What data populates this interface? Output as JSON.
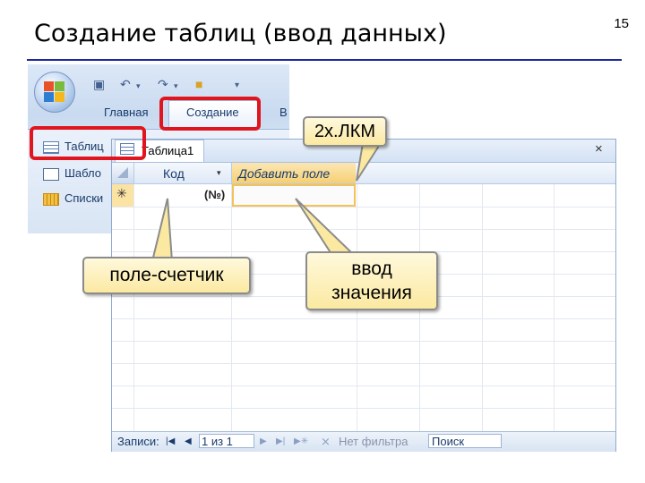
{
  "slide": {
    "title": "Создание таблиц (ввод данных)",
    "page_number": "15"
  },
  "ribbon": {
    "tabs": [
      "Главная",
      "Создание",
      "В"
    ],
    "items": [
      "Таблиц",
      "Шабло",
      "Списки"
    ]
  },
  "window": {
    "tab_title": "Таблица1",
    "close_glyph": "×",
    "columns": {
      "kod": "Код",
      "add_field": "Добавить поле"
    },
    "new_row_marker": "✳",
    "kod_value": "(№)"
  },
  "status_bar": {
    "records_label": "Записи:",
    "record_position": "1 из 1",
    "filter_label": "Нет фильтра",
    "search_label": "Поиск"
  },
  "callouts": {
    "double_click": "2х.ЛКМ",
    "counter_field": "поле-счетчик",
    "value_entry": "ввод\nзначения"
  },
  "colors": {
    "highlight": "#e0151d",
    "callout_fill": "#fbe9a1",
    "title_rule": "#1b2a9c"
  }
}
